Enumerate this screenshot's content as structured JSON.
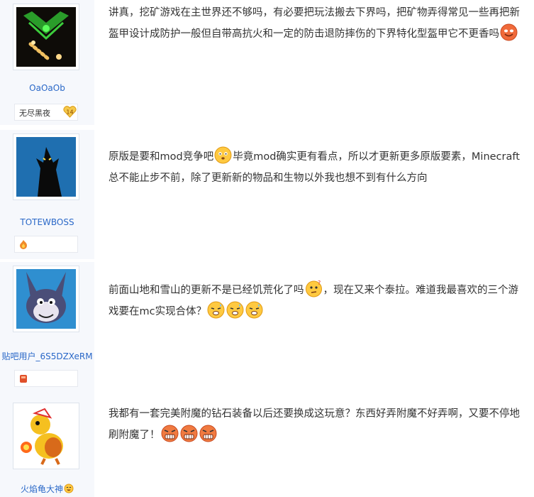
{
  "posts": [
    {
      "username": "OaOaOb",
      "badge_name": "无尽黑夜",
      "badge_level": "14",
      "content_html": "讲真，挖矿游戏在主世界还不够吗，有必要把玩法搬去下界吗，把矿物弄得常见一些再把新盔甲设计成防护一般但自带高抗火和一定的防击退防摔伤的下界特化型盔甲它不更香吗<span class=\"emoji\" data-name=\"red-smile-emoji-icon\" data-interactable=\"false\"><svg viewBox=\"0 0 25 25\" width=\"25\" height=\"25\"><circle cx=\"12.5\" cy=\"12.5\" r=\"11.5\" fill=\"#f06a3a\" stroke=\"#c94a22\"/><ellipse cx=\"8.5\" cy=\"10.5\" rx=\"2.6\" ry=\"2\" fill=\"#fff\"/><ellipse cx=\"16.5\" cy=\"10.5\" rx=\"2.6\" ry=\"2\" fill=\"#fff\"/><path d=\"M7 15 Q12.5 20 18 15\" stroke=\"#7a2a10\" stroke-width=\"1.6\" fill=\"none\"/></svg></span>"
    },
    {
      "username": "TOTEWBOSS",
      "content_html": "原版是要和mod竞争吧<span class=\"emoji\" data-name=\"surprised-emoji-icon\" data-interactable=\"false\"><svg viewBox=\"0 0 25 25\" width=\"25\" height=\"25\"><circle cx=\"12.5\" cy=\"12.5\" r=\"11.5\" fill=\"#ffc940\" stroke=\"#e09a15\"/><circle cx=\"8.5\" cy=\"10.5\" r=\"2.3\" fill=\"#fff\"/><circle cx=\"16.5\" cy=\"10.5\" r=\"2.3\" fill=\"#fff\"/><circle cx=\"8.5\" cy=\"10.8\" r=\"1\" fill=\"#333\"/><circle cx=\"16.5\" cy=\"10.8\" r=\"1\" fill=\"#333\"/><ellipse cx=\"12.5\" cy=\"17\" rx=\"2.2\" ry=\"1.6\" fill=\"#8a4a10\"/></svg></span>毕竟mod确实更有看点，所以才更新更多原版要素，Minecraft总不能止步不前，除了更新新的物品和生物以外我也想不到有什么方向"
    },
    {
      "username": "贴吧用户_6S5DZXeRM",
      "content_html": "前面山地和雪山的更新不是已经饥荒化了吗<span class=\"emoji\" data-name=\"confused-emoji-icon\" data-interactable=\"false\"><svg viewBox=\"0 0 25 25\" width=\"25\" height=\"25\"><circle cx=\"12.5\" cy=\"13\" r=\"11\" fill=\"#ffc940\" stroke=\"#e09a15\"/><circle cx=\"9\" cy=\"11\" r=\"1.6\" fill=\"#333\"/><circle cx=\"16\" cy=\"11\" r=\"1.6\" fill=\"#333\"/><path d=\"M9 18 L16 17\" stroke=\"#7a3a10\" stroke-width=\"1.4\"/><text x=\"18\" y=\"7\" font-size=\"8\" fill=\"#e03030\" font-family=\"DejaVu Sans, sans-serif\">?</text></svg></span>，现在又来个泰拉。难道我最喜欢的三个游戏要在mc实现合体？<span class=\"emoji\" data-name=\"cold-sweat-emoji-icon\" data-interactable=\"false\"><svg viewBox=\"0 0 25 25\" width=\"25\" height=\"25\"><circle cx=\"12.5\" cy=\"12.5\" r=\"11.5\" fill=\"#ffc940\" stroke=\"#e09a15\"/><path d=\"M6 10 L10 11 M19 10 L15 11\" stroke=\"#333\" stroke-width=\"1.5\"/><ellipse cx=\"12.5\" cy=\"17\" rx=\"4\" ry=\"2.5\" fill=\"#fff\" stroke=\"#7a3a10\"/><path d=\"M19 4 q2 3 0 4 q-2 -1 0 -4\" fill=\"#6fc3ff\"/></svg></span><span class=\"emoji\" data-name=\"cold-sweat-emoji-icon\" data-interactable=\"false\"><svg viewBox=\"0 0 25 25\" width=\"25\" height=\"25\"><circle cx=\"12.5\" cy=\"12.5\" r=\"11.5\" fill=\"#ffc940\" stroke=\"#e09a15\"/><path d=\"M6 10 L10 11 M19 10 L15 11\" stroke=\"#333\" stroke-width=\"1.5\"/><ellipse cx=\"12.5\" cy=\"17\" rx=\"4\" ry=\"2.5\" fill=\"#fff\" stroke=\"#7a3a10\"/><path d=\"M19 4 q2 3 0 4 q-2 -1 0 -4\" fill=\"#6fc3ff\"/></svg></span><span class=\"emoji\" data-name=\"cold-sweat-emoji-icon\" data-interactable=\"false\"><svg viewBox=\"0 0 25 25\" width=\"25\" height=\"25\"><circle cx=\"12.5\" cy=\"12.5\" r=\"11.5\" fill=\"#ffc940\" stroke=\"#e09a15\"/><path d=\"M6 10 L10 11 M19 10 L15 11\" stroke=\"#333\" stroke-width=\"1.5\"/><ellipse cx=\"12.5\" cy=\"17\" rx=\"4\" ry=\"2.5\" fill=\"#fff\" stroke=\"#7a3a10\"/><path d=\"M19 4 q2 3 0 4 q-2 -1 0 -4\" fill=\"#6fc3ff\"/></svg></span>"
    },
    {
      "username": "火焰龟大神",
      "content_html": "我都有一套完美附魔的钻石装备以后还要换成这玩意？东西好弄附魔不好弄啊，又要不停地刷附魔了！<span class=\"emoji\" data-name=\"angry-emoji-icon\" data-interactable=\"false\"><svg viewBox=\"0 0 25 25\" width=\"25\" height=\"25\"><circle cx=\"12.5\" cy=\"12.5\" r=\"11.5\" fill=\"#f07a40\" stroke=\"#c84a20\"/><path d=\"M5 8 L10 10 M20 8 L15 10\" stroke=\"#333\" stroke-width=\"1.6\"/><rect x=\"6\" y=\"14\" width=\"13\" height=\"6\" rx=\"2\" fill=\"#fff\" stroke=\"#7a2a10\"/><path d=\"M9 14 V20 M12.5 14 V20 M16 14 V20\" stroke=\"#7a2a10\" stroke-width=\"0.8\"/></svg></span><span class=\"emoji\" data-name=\"angry-emoji-icon\" data-interactable=\"false\"><svg viewBox=\"0 0 25 25\" width=\"25\" height=\"25\"><circle cx=\"12.5\" cy=\"12.5\" r=\"11.5\" fill=\"#f07a40\" stroke=\"#c84a20\"/><path d=\"M5 8 L10 10 M20 8 L15 10\" stroke=\"#333\" stroke-width=\"1.6\"/><rect x=\"6\" y=\"14\" width=\"13\" height=\"6\" rx=\"2\" fill=\"#fff\" stroke=\"#7a2a10\"/><path d=\"M9 14 V20 M12.5 14 V20 M16 14 V20\" stroke=\"#7a2a10\" stroke-width=\"0.8\"/></svg></span><span class=\"emoji\" data-name=\"angry-emoji-icon\" data-interactable=\"false\"><svg viewBox=\"0 0 25 25\" width=\"25\" height=\"25\"><circle cx=\"12.5\" cy=\"12.5\" r=\"11.5\" fill=\"#f07a40\" stroke=\"#c84a20\"/><path d=\"M5 8 L10 10 M20 8 L15 10\" stroke=\"#333\" stroke-width=\"1.6\"/><rect x=\"6\" y=\"14\" width=\"13\" height=\"6\" rx=\"2\" fill=\"#fff\" stroke=\"#7a2a10\"/><path d=\"M9 14 V20 M12.5 14 V20 M16 14 V20\" stroke=\"#7a2a10\" stroke-width=\"0.8\"/></svg></span>"
    }
  ],
  "colors": {
    "username": "#2a68c8",
    "sidebar_bg": "#f6f8fc",
    "text": "#333333"
  }
}
